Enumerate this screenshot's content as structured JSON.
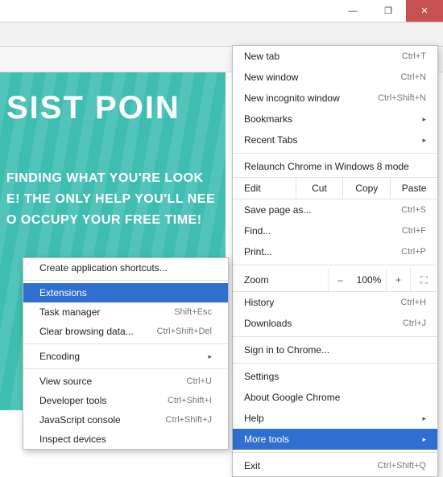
{
  "window": {
    "minimize": "—",
    "maximize": "❐",
    "close": "✕"
  },
  "toolbar": {
    "star": "☆",
    "menu": "≡"
  },
  "page": {
    "title": "SIST POIN",
    "sub1": "FINDING WHAT YOU'RE LOOK",
    "sub2": "E! THE ONLY HELP YOU'LL NEE",
    "sub3": "O OCCUPY YOUR FREE TIME!"
  },
  "menu": {
    "newtab": {
      "label": "New tab",
      "shortcut": "Ctrl+T"
    },
    "newwindow": {
      "label": "New window",
      "shortcut": "Ctrl+N"
    },
    "incognito": {
      "label": "New incognito window",
      "shortcut": "Ctrl+Shift+N"
    },
    "bookmarks": {
      "label": "Bookmarks"
    },
    "recent": {
      "label": "Recent Tabs"
    },
    "relaunch": {
      "label": "Relaunch Chrome in Windows 8 mode"
    },
    "edit": {
      "label": "Edit",
      "cut": "Cut",
      "copy": "Copy",
      "paste": "Paste"
    },
    "savepage": {
      "label": "Save page as...",
      "shortcut": "Ctrl+S"
    },
    "find": {
      "label": "Find...",
      "shortcut": "Ctrl+F"
    },
    "print": {
      "label": "Print...",
      "shortcut": "Ctrl+P"
    },
    "zoom": {
      "label": "Zoom",
      "minus": "–",
      "value": "100%",
      "plus": "+",
      "full": "⛶"
    },
    "history": {
      "label": "History",
      "shortcut": "Ctrl+H"
    },
    "downloads": {
      "label": "Downloads",
      "shortcut": "Ctrl+J"
    },
    "signin": {
      "label": "Sign in to Chrome..."
    },
    "settings": {
      "label": "Settings"
    },
    "about": {
      "label": "About Google Chrome"
    },
    "help": {
      "label": "Help"
    },
    "moretools": {
      "label": "More tools"
    },
    "exit": {
      "label": "Exit",
      "shortcut": "Ctrl+Shift+Q"
    }
  },
  "submenu": {
    "shortcuts": {
      "label": "Create application shortcuts..."
    },
    "extensions": {
      "label": "Extensions"
    },
    "taskmgr": {
      "label": "Task manager",
      "shortcut": "Shift+Esc"
    },
    "clear": {
      "label": "Clear browsing data...",
      "shortcut": "Ctrl+Shift+Del"
    },
    "encoding": {
      "label": "Encoding"
    },
    "viewsource": {
      "label": "View source",
      "shortcut": "Ctrl+U"
    },
    "devtools": {
      "label": "Developer tools",
      "shortcut": "Ctrl+Shift+I"
    },
    "jsconsole": {
      "label": "JavaScript console",
      "shortcut": "Ctrl+Shift+J"
    },
    "inspect": {
      "label": "Inspect devices"
    }
  },
  "arrow": "▸"
}
